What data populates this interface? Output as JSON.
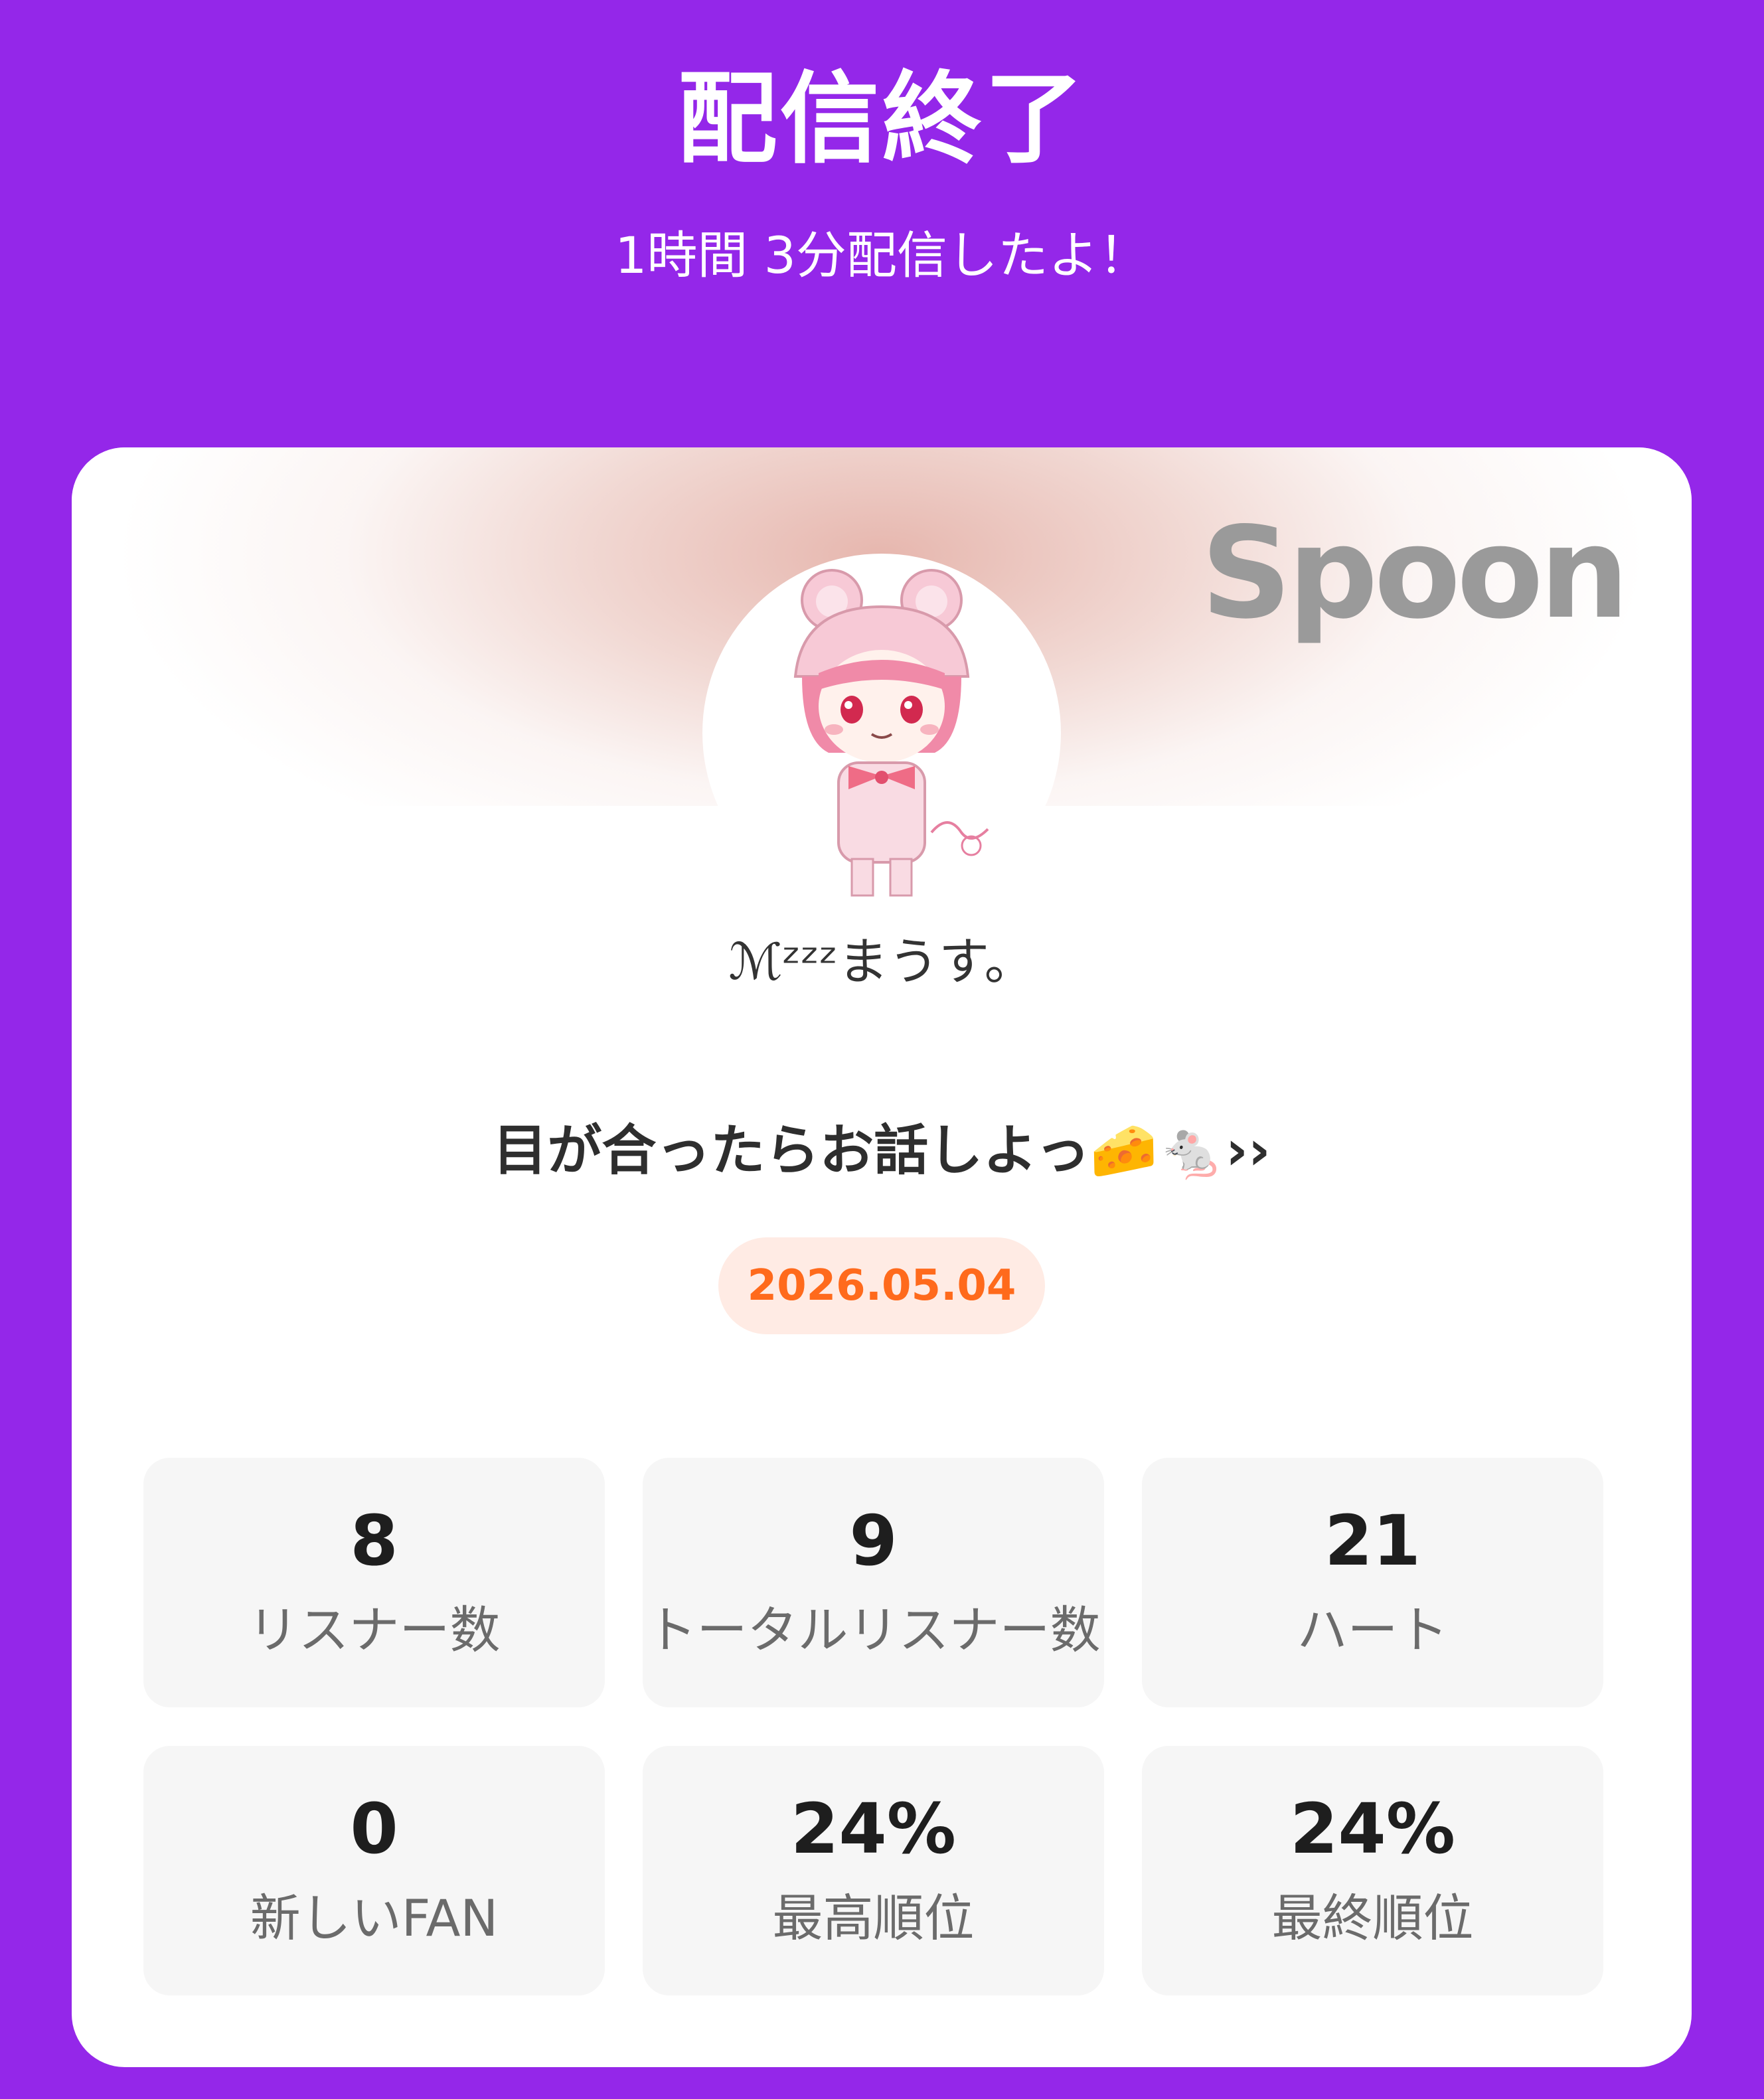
{
  "header": {
    "title": "配信終了",
    "subtitle": "1時間 3分配信したよ！"
  },
  "card": {
    "logo": "Spoon",
    "username": "ℳᶻᶻᶻまうす。",
    "stream_title": "目が合ったらお話しよっ🧀🐁››",
    "date": "2026.05.04",
    "stats": [
      {
        "value": "8",
        "label": "リスナー数"
      },
      {
        "value": "9",
        "label": "トータルリスナー数"
      },
      {
        "value": "21",
        "label": "ハート"
      },
      {
        "value": "0",
        "label": "新しいFAN"
      },
      {
        "value": "24%",
        "label": "最高順位"
      },
      {
        "value": "24%",
        "label": "最終順位"
      }
    ]
  },
  "colors": {
    "background": "#9427E9",
    "date_text": "#FF6A1C",
    "date_badge_bg": "#FFEBE4"
  },
  "icons": {
    "avatar": "avatar-image"
  }
}
